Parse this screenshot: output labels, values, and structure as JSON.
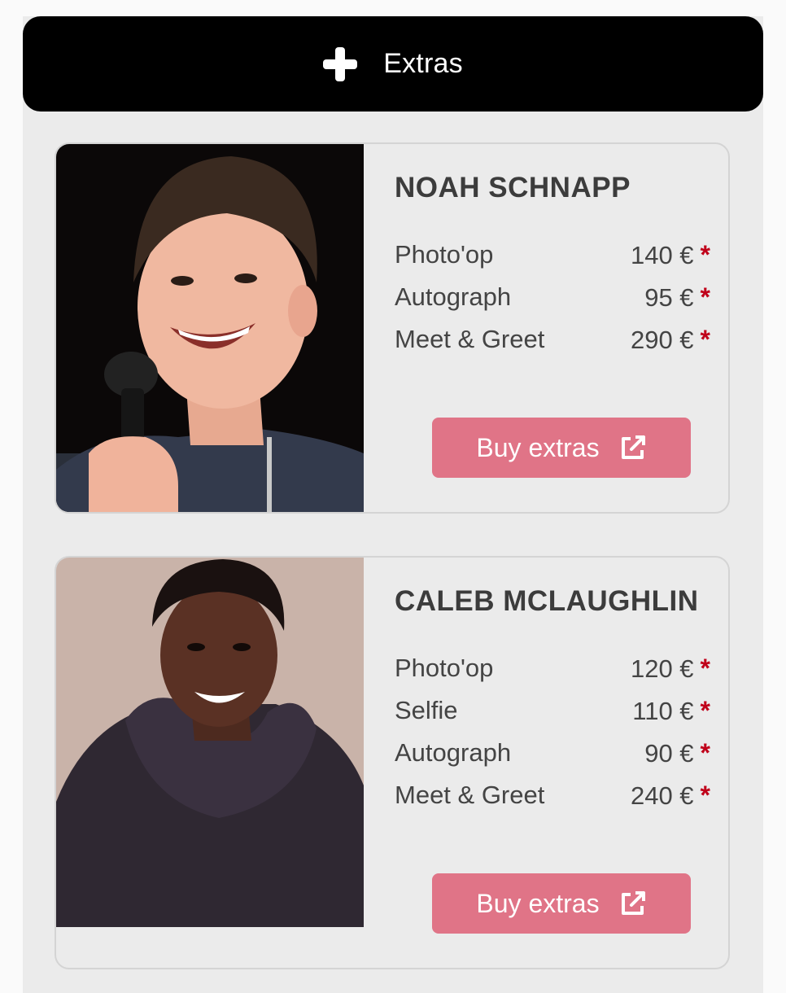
{
  "header": {
    "title": "Extras",
    "icon": "plus-icon"
  },
  "guests": [
    {
      "name": "NOAH SCHNAPP",
      "items": [
        {
          "label": "Photo'op",
          "price": "140 €"
        },
        {
          "label": "Autograph",
          "price": "95 €"
        },
        {
          "label": "Meet & Greet",
          "price": "290 €"
        }
      ],
      "button_label": "Buy extras"
    },
    {
      "name": "CALEB MCLAUGHLIN",
      "items": [
        {
          "label": "Photo'op",
          "price": "120 €"
        },
        {
          "label": "Selfie",
          "price": "110 €"
        },
        {
          "label": "Autograph",
          "price": "90 €"
        },
        {
          "label": "Meet & Greet",
          "price": "240 €"
        }
      ],
      "button_label": "Buy extras"
    }
  ],
  "asterisk": "*",
  "colors": {
    "header_bg": "#000000",
    "panel_bg": "#ebebeb",
    "button_bg": "#e07487",
    "asterisk": "#c0001a",
    "text": "#444444"
  }
}
